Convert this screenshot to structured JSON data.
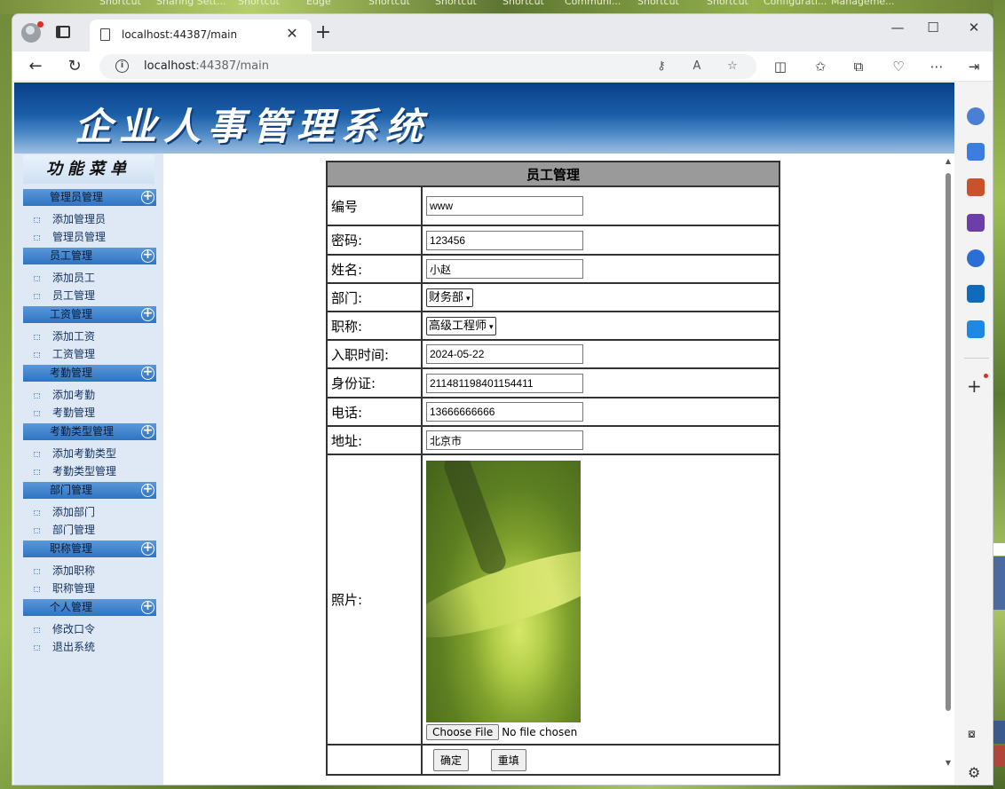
{
  "desktop": {
    "labels": [
      "Shortcut",
      "Sharing Sett...",
      "Shortcut",
      "Edge",
      "Shortcut",
      "Shortcut",
      "Shortcut",
      "Communi...",
      "Shortcut",
      "Shortcut",
      "Configurati...",
      "Manageme..."
    ]
  },
  "browser": {
    "tab_title": "localhost:44387/main",
    "url_host": "localhost",
    "url_rest": ":44387/main",
    "window_controls": [
      "—",
      "☐",
      "✕"
    ]
  },
  "banner": {
    "title": "企业人事管理系统"
  },
  "menu": {
    "heading": "功能菜单",
    "groups": [
      {
        "label": "管理员管理",
        "items": [
          "添加管理员",
          "管理员管理"
        ]
      },
      {
        "label": "员工管理",
        "items": [
          "添加员工",
          "员工管理"
        ]
      },
      {
        "label": "工资管理",
        "items": [
          "添加工资",
          "工资管理"
        ]
      },
      {
        "label": "考勤管理",
        "items": [
          "添加考勤",
          "考勤管理"
        ]
      },
      {
        "label": "考勤类型管理",
        "items": [
          "添加考勤类型",
          "考勤类型管理"
        ]
      },
      {
        "label": "部门管理",
        "items": [
          "添加部门",
          "部门管理"
        ]
      },
      {
        "label": "职称管理",
        "items": [
          "添加职称",
          "职称管理"
        ]
      },
      {
        "label": "个人管理",
        "items": [
          "修改口令",
          "退出系统"
        ]
      }
    ]
  },
  "form": {
    "title": "员工管理",
    "fields": {
      "id": {
        "label": "编号",
        "value": "www"
      },
      "password": {
        "label": "密码:",
        "value": "123456"
      },
      "name": {
        "label": "姓名:",
        "value": "小赵"
      },
      "department": {
        "label": "部门:",
        "value": "财务部"
      },
      "title": {
        "label": "职称:",
        "value": "高级工程师"
      },
      "hire_date": {
        "label": "入职时间:",
        "value": "2024-05-22"
      },
      "id_card": {
        "label": "身份证:",
        "value": "211481198401154411"
      },
      "phone": {
        "label": "电话:",
        "value": "13666666666"
      },
      "address": {
        "label": "地址:",
        "value": "北京市"
      },
      "photo": {
        "label": "照片:",
        "file_button": "Choose File",
        "file_status": "No file chosen"
      }
    },
    "submit_label": "确定",
    "reset_label": "重填"
  }
}
